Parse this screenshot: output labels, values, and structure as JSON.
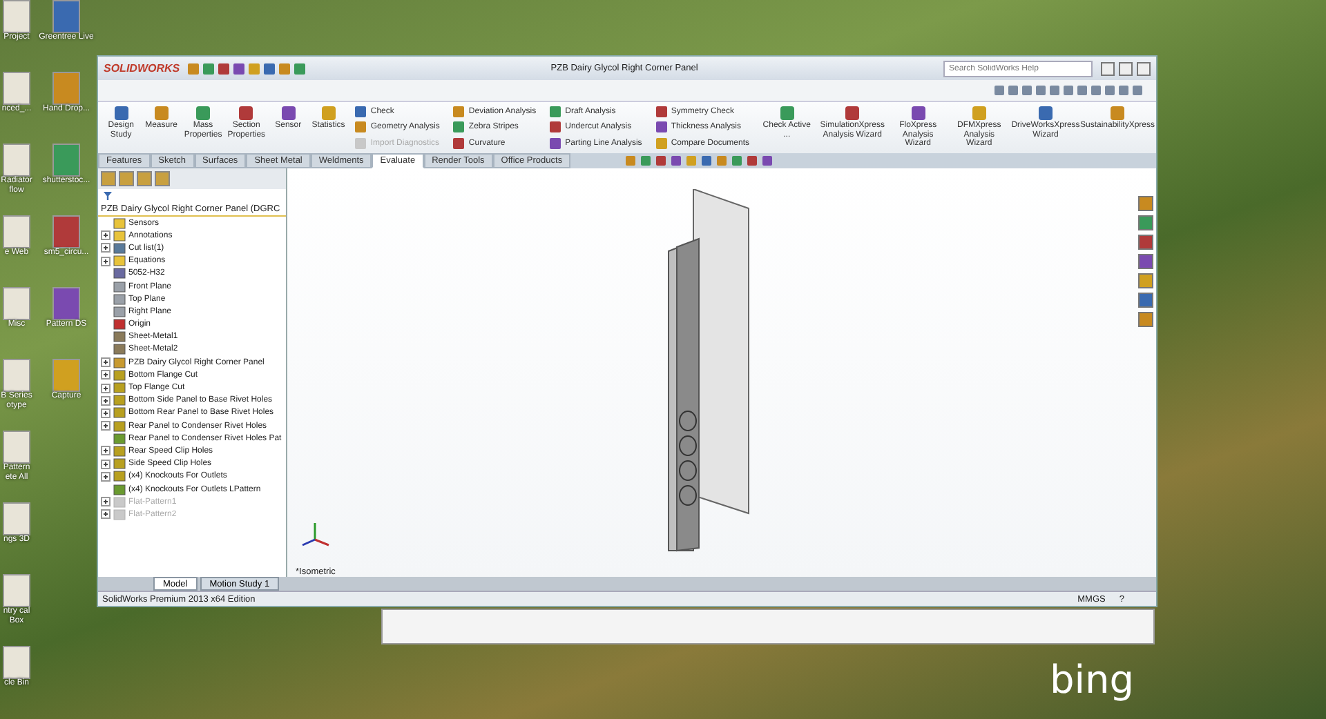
{
  "desktop": {
    "icons": [
      {
        "left": "Project",
        "right": "Greentree Live"
      },
      {
        "left": "nced_...",
        "right": "Hand Drop..."
      },
      {
        "left": "Radiator flow",
        "right": "shutterstoc..."
      },
      {
        "left": "e Web",
        "right": "sm5_circu..."
      },
      {
        "left": "Misc",
        "right": "Pattern DS"
      },
      {
        "left": "B Series otype",
        "right": "Capture"
      },
      {
        "left": "Pattern ete All"
      },
      {
        "left": "ngs 3D"
      },
      {
        "left": "ntry cal Box"
      },
      {
        "left": "cle Bin"
      }
    ],
    "logo": "bing"
  },
  "window": {
    "brand": "SOLIDWORKS",
    "title": "PZB Dairy Glycol Right Corner Panel",
    "search": {
      "placeholder": "Search SolidWorks Help"
    }
  },
  "ribbon": {
    "large_left": [
      "Design Study",
      "Measure",
      "Mass Properties",
      "Section Properties",
      "Sensor",
      "Statistics"
    ],
    "columns": [
      [
        {
          "label": "Check",
          "disabled": false
        },
        {
          "label": "Geometry Analysis",
          "disabled": false
        },
        {
          "label": "Import Diagnostics",
          "disabled": true
        }
      ],
      [
        {
          "label": "Deviation Analysis",
          "disabled": false
        },
        {
          "label": "Zebra Stripes",
          "disabled": false
        },
        {
          "label": "Curvature",
          "disabled": false
        }
      ],
      [
        {
          "label": "Draft Analysis",
          "disabled": false
        },
        {
          "label": "Undercut Analysis",
          "disabled": false
        },
        {
          "label": "Parting Line Analysis",
          "disabled": false
        }
      ],
      [
        {
          "label": "Symmetry Check",
          "disabled": false
        },
        {
          "label": "Thickness Analysis",
          "disabled": false
        },
        {
          "label": "Compare Documents",
          "disabled": false
        }
      ]
    ],
    "large_right": [
      "Check Active ...",
      "SimulationXpress Analysis Wizard",
      "FloXpress Analysis Wizard",
      "DFMXpress Analysis Wizard",
      "DriveWorksXpress Wizard",
      "SustainabilityXpress"
    ]
  },
  "tabs": [
    {
      "label": "Features",
      "selected": false
    },
    {
      "label": "Sketch",
      "selected": false
    },
    {
      "label": "Surfaces",
      "selected": false
    },
    {
      "label": "Sheet Metal",
      "selected": false
    },
    {
      "label": "Weldments",
      "selected": false
    },
    {
      "label": "Evaluate",
      "selected": true
    },
    {
      "label": "Render Tools",
      "selected": false
    },
    {
      "label": "Office Products",
      "selected": false
    }
  ],
  "tree": {
    "root": "PZB Dairy Glycol Right Corner Panel  (DGRC",
    "items": [
      {
        "label": "Sensors",
        "kind": "folder",
        "disabled": false
      },
      {
        "label": "Annotations",
        "kind": "annotation",
        "expanded": false,
        "disabled": false
      },
      {
        "label": "Cut list(1)",
        "kind": "cutlist",
        "expanded": false,
        "disabled": false
      },
      {
        "label": "Equations",
        "kind": "folder",
        "expanded": false,
        "disabled": false
      },
      {
        "label": "5052-H32",
        "kind": "material",
        "disabled": false
      },
      {
        "label": "Front Plane",
        "kind": "plane",
        "disabled": false
      },
      {
        "label": "Top Plane",
        "kind": "plane",
        "disabled": false
      },
      {
        "label": "Right Plane",
        "kind": "plane",
        "disabled": false
      },
      {
        "label": "Origin",
        "kind": "origin",
        "disabled": false
      },
      {
        "label": "Sheet-Metal1",
        "kind": "sheetmetal",
        "disabled": false
      },
      {
        "label": "Sheet-Metal2",
        "kind": "sheetmetal",
        "disabled": false
      },
      {
        "label": "PZB Dairy Glycol Right Corner Panel",
        "kind": "part",
        "expanded": false,
        "disabled": false
      },
      {
        "label": "Bottom Flange Cut",
        "kind": "feature",
        "expanded": false,
        "disabled": false
      },
      {
        "label": "Top Flange Cut",
        "kind": "feature",
        "expanded": false,
        "disabled": false
      },
      {
        "label": "Bottom Side Panel to Base Rivet Holes",
        "kind": "feature",
        "expanded": false,
        "disabled": false
      },
      {
        "label": "Bottom Rear Panel to Base Rivet Holes",
        "kind": "feature",
        "expanded": false,
        "disabled": false
      },
      {
        "label": "Rear Panel to Condenser Rivet Holes",
        "kind": "feature",
        "expanded": false,
        "disabled": false
      },
      {
        "label": "Rear Panel to Condenser Rivet Holes Pat",
        "kind": "pattern",
        "disabled": false
      },
      {
        "label": "Rear Speed Clip Holes",
        "kind": "feature",
        "expanded": false,
        "disabled": false
      },
      {
        "label": "Side Speed Clip Holes",
        "kind": "feature",
        "expanded": false,
        "disabled": false
      },
      {
        "label": "(x4) Knockouts For Outlets",
        "kind": "feature",
        "expanded": false,
        "disabled": false
      },
      {
        "label": "(x4) Knockouts For Outlets LPattern",
        "kind": "pattern",
        "disabled": false
      },
      {
        "label": "Flat-Pattern1",
        "kind": "flat",
        "expanded": false,
        "disabled": true
      },
      {
        "label": "Flat-Pattern2",
        "kind": "flat",
        "expanded": false,
        "disabled": true
      }
    ]
  },
  "viewport": {
    "view_label": "*Isometric"
  },
  "bottom_tabs": [
    {
      "label": "Model",
      "selected": true
    },
    {
      "label": "Motion Study 1",
      "selected": false
    }
  ],
  "status_bar": {
    "edition": "SolidWorks Premium 2013 x64 Edition",
    "units": "MMGS",
    "help": "?"
  }
}
